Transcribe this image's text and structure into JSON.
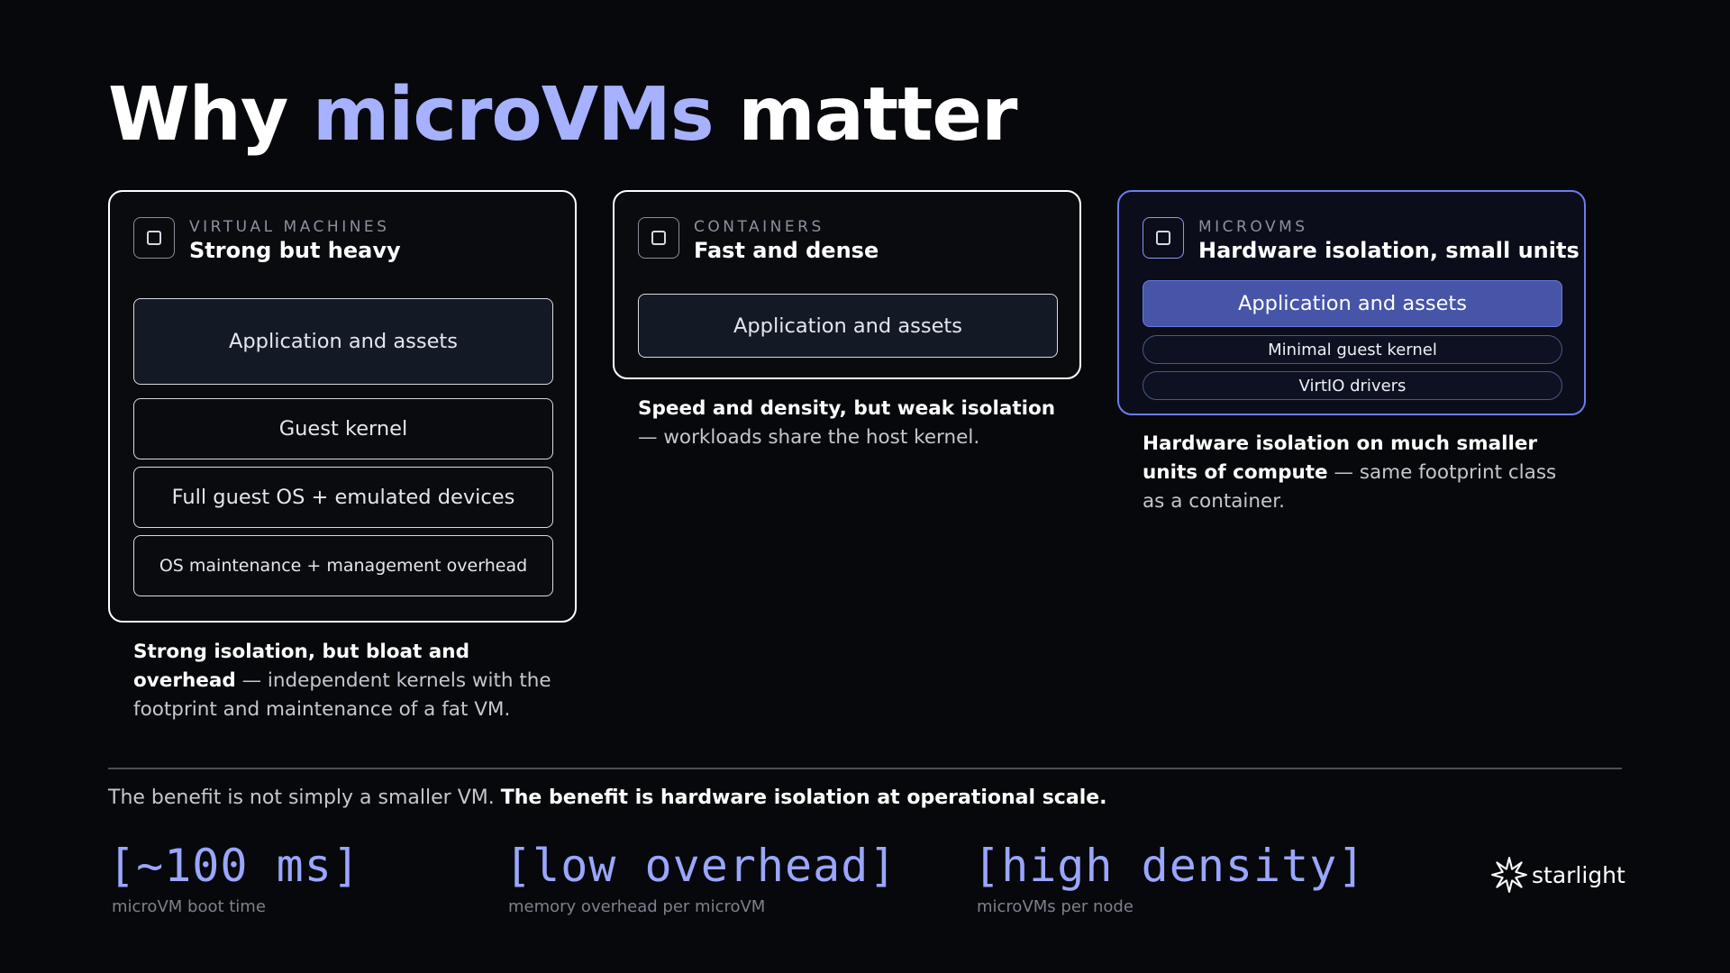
{
  "title": {
    "prefix": "Why ",
    "accent": "microVMs",
    "suffix": " matter"
  },
  "cards": [
    {
      "kicker": "VIRTUAL MACHINES",
      "heading": "Strong but heavy",
      "layers": [
        "Application and assets",
        "Guest kernel",
        "Full guest OS + emulated devices",
        "OS maintenance + management overhead"
      ],
      "caption_bold": "Strong isolation, but bloat and overhead",
      "caption_rest": " — independent kernels with the footprint and maintenance of a fat VM."
    },
    {
      "kicker": "CONTAINERS",
      "heading": "Fast and dense",
      "layers": [
        "Application and assets"
      ],
      "caption_bold": "Speed and density, but weak isolation",
      "caption_rest": " — workloads share the host kernel."
    },
    {
      "kicker": "MICROVMS",
      "heading": "Hardware isolation, small units",
      "layers": [
        "Application and assets",
        "Minimal guest kernel",
        "VirtIO drivers"
      ],
      "caption_bold": "Hardware isolation on much smaller units of compute",
      "caption_rest": " — same footprint class as a container."
    }
  ],
  "summary": {
    "plain": "The benefit is not simply a smaller VM. ",
    "bold": "The benefit is hardware isolation at operational scale."
  },
  "stats": [
    {
      "value": "[~100 ms]",
      "label": "microVM boot time"
    },
    {
      "value": "[low overhead]",
      "label": "memory overhead per microVM"
    },
    {
      "value": "[high density]",
      "label": "microVMs per node"
    }
  ],
  "brand": {
    "name": "starlight",
    "icon": "starburst-logo-icon"
  },
  "colors": {
    "background": "#07080b",
    "accent": "#a6b1ff",
    "microvm_border": "#6d7cf0",
    "microvm_fill": "#4655a8"
  }
}
